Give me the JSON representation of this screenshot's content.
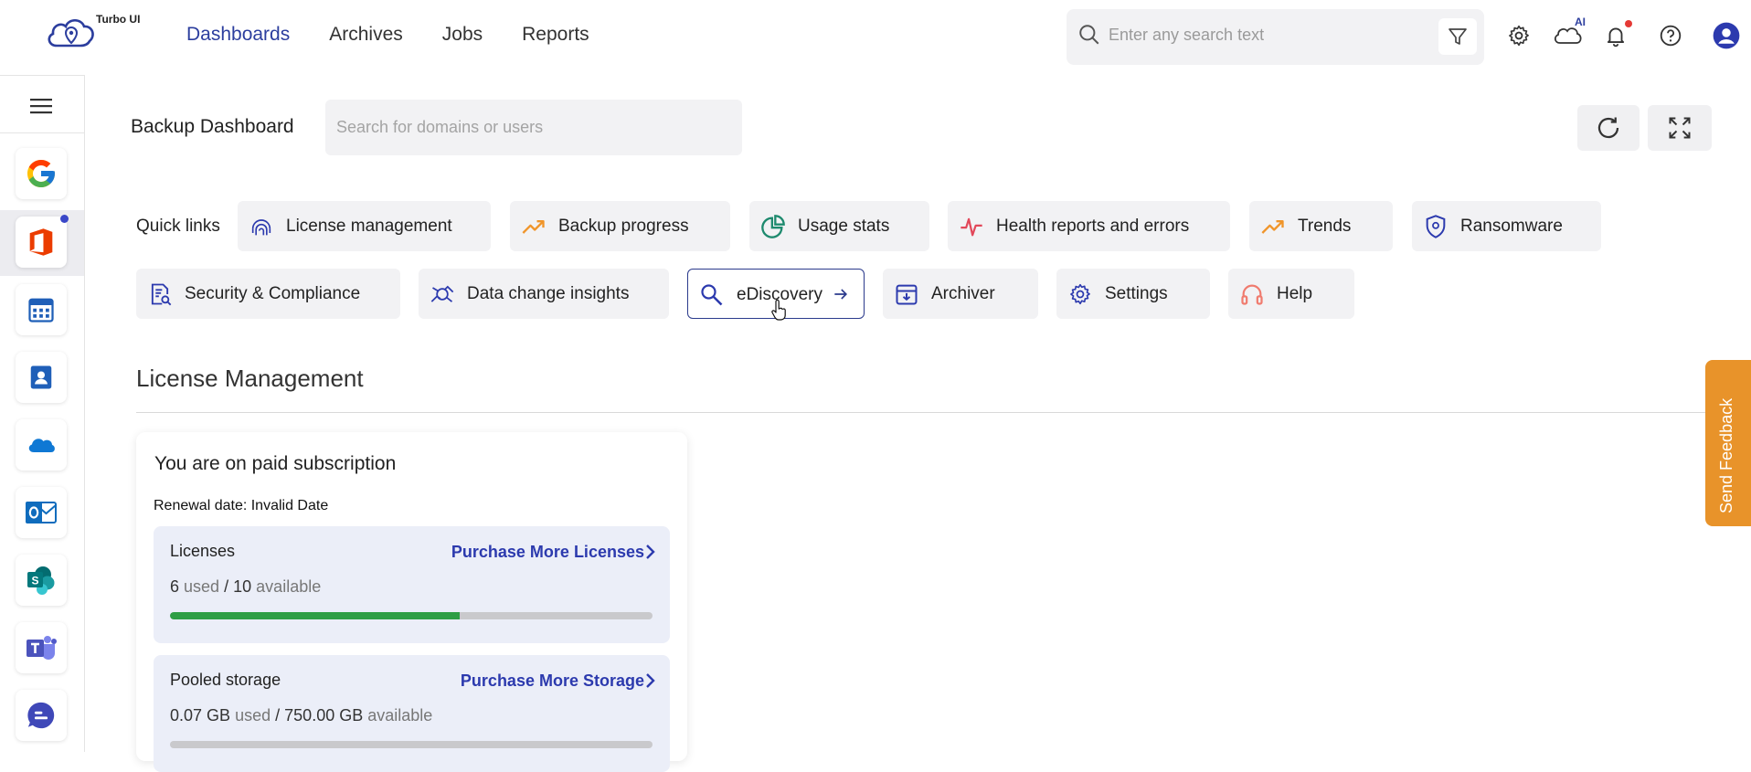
{
  "app": {
    "logo_text": "Turbo UI"
  },
  "nav": {
    "items": [
      "Dashboards",
      "Archives",
      "Jobs",
      "Reports"
    ],
    "active": "Dashboards"
  },
  "global_search": {
    "placeholder": "Enter any search text"
  },
  "top_icons": {
    "ai_badge": "AI"
  },
  "dashboard": {
    "title": "Backup Dashboard",
    "search_placeholder": "Search for domains or users"
  },
  "quick_links": {
    "label": "Quick links",
    "items": [
      {
        "label": "License management",
        "icon": "license-icon"
      },
      {
        "label": "Backup progress",
        "icon": "trend-up-icon"
      },
      {
        "label": "Usage stats",
        "icon": "pie-chart-icon"
      },
      {
        "label": "Health reports and errors",
        "icon": "pulse-icon"
      },
      {
        "label": "Trends",
        "icon": "trend-up-icon"
      },
      {
        "label": "Ransomware",
        "icon": "shield-icon"
      },
      {
        "label": "Security & Compliance",
        "icon": "document-search-icon"
      },
      {
        "label": "Data change insights",
        "icon": "insights-icon"
      },
      {
        "label": "eDiscovery",
        "icon": "magnifier-icon"
      },
      {
        "label": "Archiver",
        "icon": "archive-icon"
      },
      {
        "label": "Settings",
        "icon": "gear-icon"
      },
      {
        "label": "Help",
        "icon": "headset-icon"
      }
    ]
  },
  "license_management": {
    "title": "License Management",
    "card": {
      "title": "You are on paid subscription",
      "renewal": "Renewal date: Invalid Date",
      "licenses": {
        "title": "Licenses",
        "link": "Purchase More Licenses",
        "used": "6",
        "used_word": "used",
        "sep": "/",
        "available": "10",
        "available_word": "available",
        "fraction": 0.6
      },
      "storage": {
        "title": "Pooled storage",
        "link": "Purchase More Storage",
        "used": "0.07 GB",
        "used_word": "used",
        "sep": "/",
        "available": "750.00 GB",
        "available_word": "available",
        "fraction": 0.0001
      }
    }
  },
  "feedback": {
    "label": "Send Feedback"
  },
  "colors": {
    "accent": "#2c3aae",
    "brand": "#2c3e9e",
    "progress": "#2e9e45",
    "feedback": "#e8932a",
    "alert": "#e53935"
  }
}
